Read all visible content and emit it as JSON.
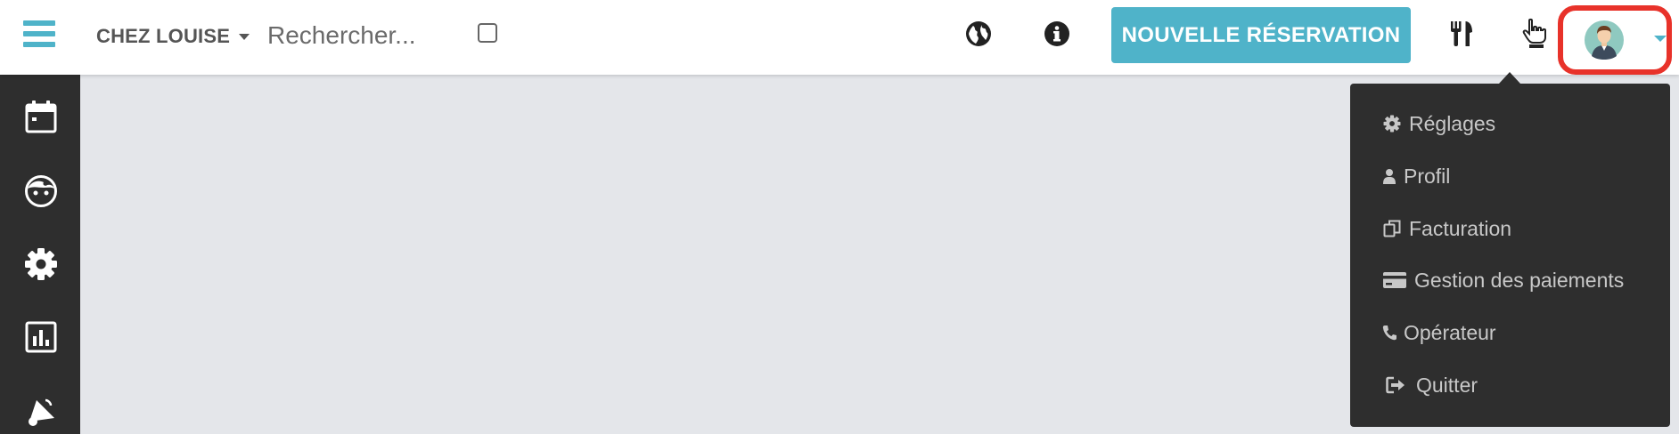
{
  "header": {
    "restaurant_name": "CHEZ LOUISE",
    "search_placeholder": "Rechercher...",
    "new_reservation_label": "NOUVELLE RÉSERVATION",
    "icons": [
      "globe-icon",
      "info-icon",
      "utensils-icon",
      "hand-pointer-icon"
    ],
    "accent_color": "#4fb3c9",
    "highlight_color": "#e8322a"
  },
  "sidebar": {
    "items": [
      {
        "icon": "calendar-icon"
      },
      {
        "icon": "face-icon"
      },
      {
        "icon": "gear-icon"
      },
      {
        "icon": "chart-icon"
      },
      {
        "icon": "megaphone-icon"
      }
    ]
  },
  "user_menu": {
    "items": [
      {
        "label": "Réglages",
        "icon": "gear-icon"
      },
      {
        "label": "Profil",
        "icon": "user-icon"
      },
      {
        "label": "Facturation",
        "icon": "copy-icon"
      },
      {
        "label": "Gestion des paiements",
        "icon": "credit-card-icon"
      },
      {
        "label": "Opérateur",
        "icon": "phone-icon"
      },
      {
        "label": "Quitter",
        "icon": "sign-out-icon"
      }
    ]
  }
}
